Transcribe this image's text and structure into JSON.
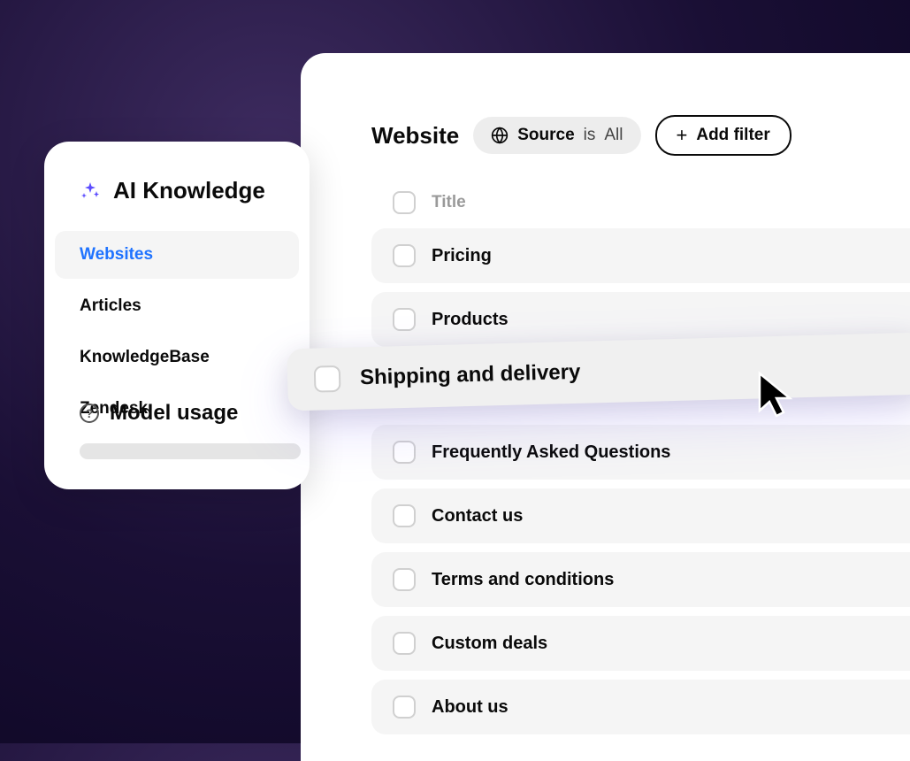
{
  "sidebar": {
    "heading": "AI Knowledge",
    "items": [
      {
        "label": "Websites",
        "active": true
      },
      {
        "label": "Articles",
        "active": false
      },
      {
        "label": "KnowledgeBase",
        "active": false
      },
      {
        "label": "Zendesk",
        "active": false
      }
    ],
    "model_usage_label": "Model usage"
  },
  "main": {
    "title": "Website",
    "filter": {
      "label": "Source",
      "middle": "is",
      "value": "All"
    },
    "add_filter_label": "Add filter",
    "column_header": "Title",
    "rows": [
      {
        "title": "Pricing"
      },
      {
        "title": "Products"
      },
      {
        "title": "Shipping and delivery",
        "highlighted": true
      },
      {
        "title": "Frequently Asked Questions"
      },
      {
        "title": "Contact us"
      },
      {
        "title": "Terms and conditions"
      },
      {
        "title": "Custom deals"
      },
      {
        "title": "About us"
      }
    ]
  }
}
